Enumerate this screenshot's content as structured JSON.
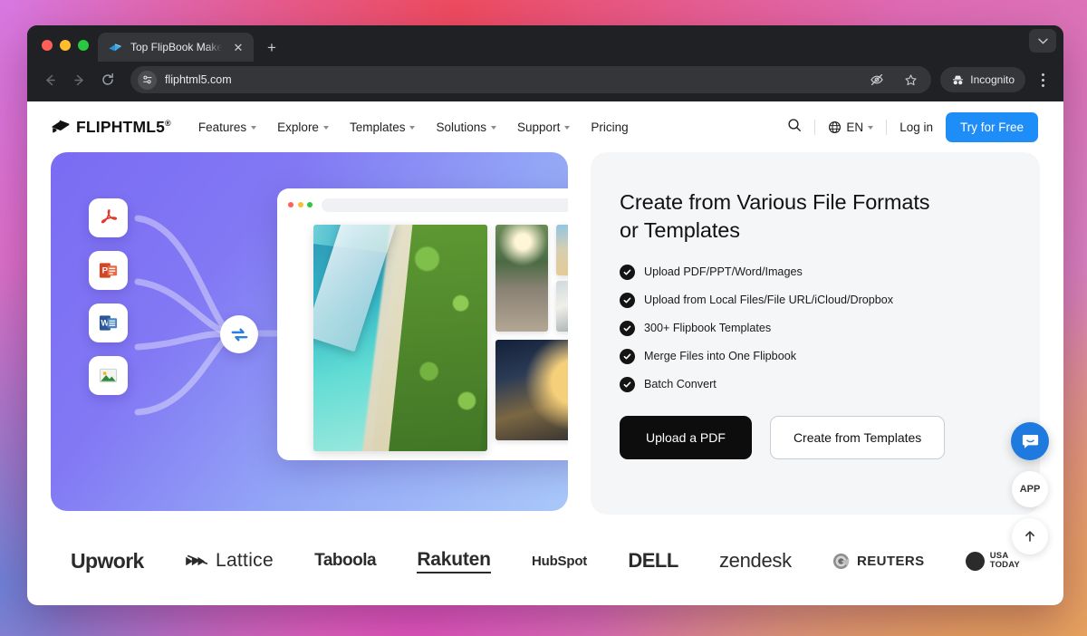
{
  "browser": {
    "tab": {
      "title": "Top FlipBook Maker & Digital Publishing Software",
      "favicon_icon": "flipbook-favicon",
      "close_icon": "close-icon"
    },
    "new_tab_icon": "plus-icon",
    "window_caret_icon": "chevron-down-icon",
    "back_icon": "arrow-left-icon",
    "forward_icon": "arrow-right-icon",
    "reload_icon": "reload-icon",
    "url": "fliphtml5.com",
    "site_info_icon": "page-settings-icon",
    "tracking_icon": "eye-off-icon",
    "bookmark_icon": "star-icon",
    "incognito_label": "Incognito",
    "incognito_icon": "incognito-icon",
    "menu_icon": "kebab-menu-icon"
  },
  "site": {
    "brand": {
      "name": "FLIPHTML5",
      "registered": "®",
      "logo_icon": "flipbook-logo-icon"
    },
    "nav": [
      {
        "label": "Features",
        "has_caret": true
      },
      {
        "label": "Explore",
        "has_caret": true
      },
      {
        "label": "Templates",
        "has_caret": true
      },
      {
        "label": "Solutions",
        "has_caret": true
      },
      {
        "label": "Support",
        "has_caret": true
      },
      {
        "label": "Pricing",
        "has_caret": false
      }
    ],
    "search_icon": "search-icon",
    "language": {
      "label": "EN",
      "globe_icon": "globe-icon"
    },
    "login_label": "Log in",
    "cta_label": "Try for Free",
    "cta_color": "#1f8df7"
  },
  "hero": {
    "illustration": {
      "file_icons": [
        "pdf-file-icon",
        "powerpoint-file-icon",
        "word-file-icon",
        "image-file-icon"
      ],
      "convert_icon": "sync-convert-icon",
      "mockup_window": {
        "dots": [
          "#ff5f57",
          "#febc2e",
          "#28c840"
        ],
        "main_page_alt": "aerial-beach-photo",
        "thumbnails": [
          "suspension-bridge-cyclist-photo",
          "sand-dune-photo",
          "coastal-town-photo",
          "night-camper-van-photo"
        ]
      },
      "gradient_from": "#7a6cf3",
      "gradient_to": "#a9c8f8"
    },
    "heading": "Create from Various File Formats or Templates",
    "features": [
      "Upload PDF/PPT/Word/Images",
      "Upload from Local Files/File URL/iCloud/Dropbox",
      "300+ Flipbook Templates",
      "Merge Files into One Flipbook",
      "Batch Convert"
    ],
    "primary_button": "Upload a PDF",
    "secondary_button": "Create from Templates",
    "panel_bg": "#f5f6f8"
  },
  "logos": [
    {
      "name": "Upwork",
      "key": "upwork"
    },
    {
      "name": "Lattice",
      "key": "lattice"
    },
    {
      "name": "Taboola",
      "key": "taboola"
    },
    {
      "name": "Rakuten",
      "key": "rakuten"
    },
    {
      "name": "HubSpot",
      "key": "hubspot"
    },
    {
      "name": "DELL",
      "key": "dell"
    },
    {
      "name": "zendesk",
      "key": "zendesk"
    },
    {
      "name": "REUTERS",
      "key": "reuters"
    },
    {
      "name": "USA TODAY",
      "key": "usatoday",
      "line1": "USA",
      "line2": "TODAY"
    }
  ],
  "widgets": {
    "chat_icon": "chat-bubble-icon",
    "app_label": "APP",
    "scroll_top_icon": "arrow-up-icon"
  }
}
